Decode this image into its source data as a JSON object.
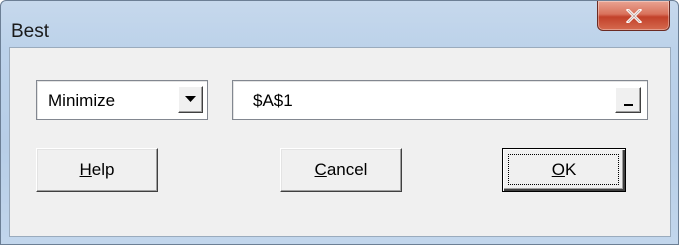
{
  "window": {
    "title": "Best"
  },
  "objective": {
    "selected": "Minimize"
  },
  "reference": {
    "value": "$A$1"
  },
  "buttons": {
    "help": {
      "mnemonic": "H",
      "rest": "elp"
    },
    "cancel": {
      "mnemonic": "C",
      "rest": "ancel"
    },
    "ok": {
      "mnemonic": "O",
      "rest": "K"
    }
  },
  "icons": {
    "close": "close-icon",
    "dropdown": "chevron-down-icon",
    "collapse": "collapse-dialog-icon"
  },
  "colors": {
    "titlebar": "#bcd2ea",
    "close_button": "#c9503a",
    "client_bg": "#f0f0f0"
  }
}
